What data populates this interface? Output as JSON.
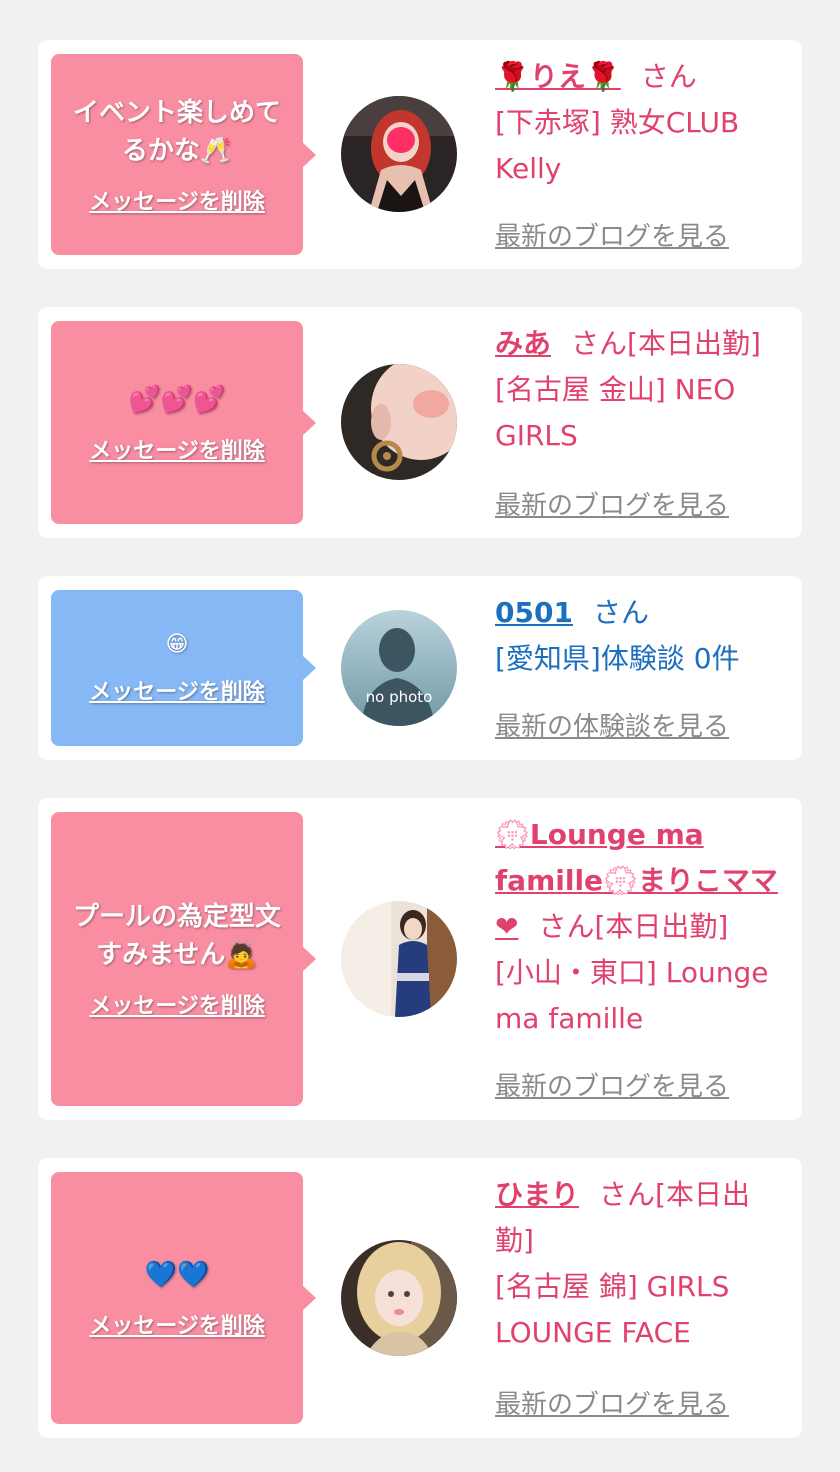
{
  "cards": [
    {
      "message": "イベント楽しめてるかな🥂",
      "delete_label": "メッセージを削除",
      "name": "🌹りえ🌹",
      "san_suffix": "さん",
      "location": "[下赤塚] 熟女CLUB Kelly",
      "blog_link": "最新のブログを見る",
      "bubble_color": "#f98da2",
      "text_color": "#e0426d"
    },
    {
      "message": "💕💕💕",
      "delete_label": "メッセージを削除",
      "name": "みあ",
      "san_suffix": "さん[本日出勤]",
      "location": "[名古屋 金山] NEO GIRLS",
      "blog_link": "最新のブログを見る",
      "bubble_color": "#f98da2",
      "text_color": "#e0426d"
    },
    {
      "message": "😁",
      "delete_label": "メッセージを削除",
      "name": "0501",
      "san_suffix": "さん",
      "location": "[愛知県]体験談 0件",
      "blog_link": "最新の体験談を見る",
      "avatar_label": "no photo",
      "bubble_color": "#86b8f6",
      "text_color": "#1c6fbf"
    },
    {
      "message": "プールの為定型文すみません🙇",
      "delete_label": "メッセージを削除",
      "name": "💮Lounge ma famille💮まりこママ❤",
      "san_suffix": "さん[本日出勤]",
      "location": "[小山・東口] Lounge ma famille",
      "blog_link": "最新のブログを見る",
      "bubble_color": "#f98da2",
      "text_color": "#e0426d"
    },
    {
      "message": "💙💙",
      "delete_label": "メッセージを削除",
      "name": "ひまり",
      "san_suffix": "さん[本日出勤]",
      "location": "[名古屋 錦] GIRLS LOUNGE FACE",
      "blog_link": "最新のブログを見る",
      "bubble_color": "#f98da2",
      "text_color": "#e0426d"
    }
  ]
}
